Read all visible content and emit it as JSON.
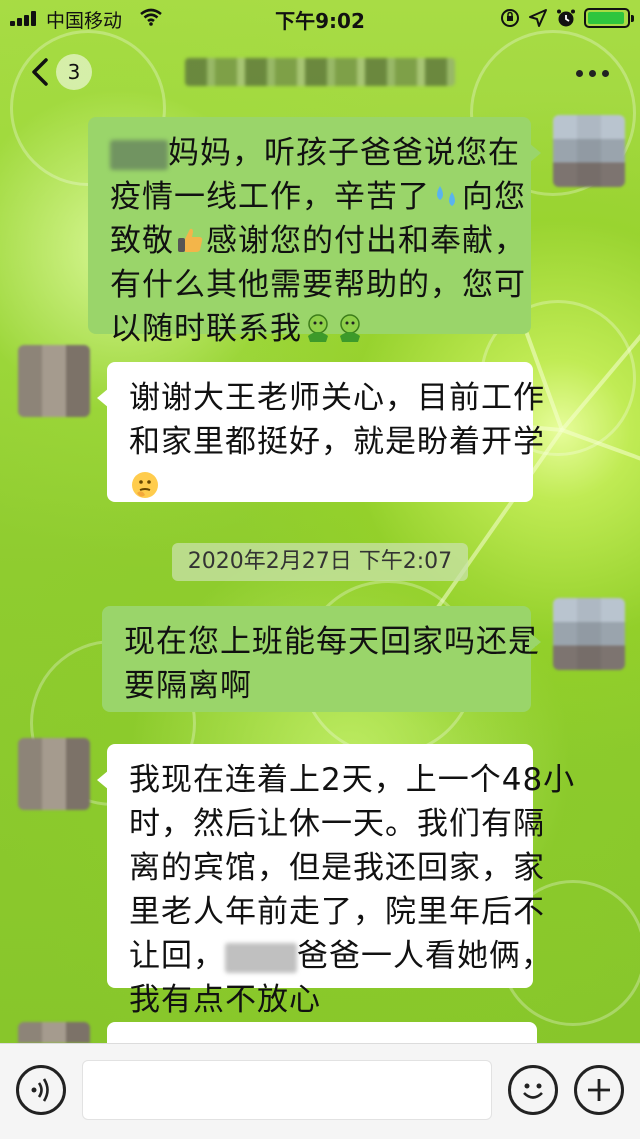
{
  "status_bar": {
    "carrier": "中国移动",
    "time": "下午9:02",
    "battery_level": 1.0,
    "icons": [
      "signal-icon",
      "wifi-icon",
      "rotation-lock-icon",
      "location-icon",
      "alarm-icon",
      "battery-icon"
    ]
  },
  "nav": {
    "back_icon": "chevron-left-icon",
    "unread_count": "3",
    "more_icon": "more-icon"
  },
  "messages": [
    {
      "side": "right",
      "lines": [
        "妈妈，听孩子爸爸说您在",
        "疫情一线工作，辛苦了",
        "致敬",
        "有什么其他需要帮助的，您可",
        "以随时联系我"
      ],
      "parts": {
        "l1": "妈妈，听孩子爸爸说您在",
        "l2a": "疫情一线工作，辛苦了",
        "l2b": "向您",
        "l3a": "致敬",
        "l3b": "感谢您的付出和奉献，",
        "l4": "有什么其他需要帮助的，您可",
        "l5": "以随时联系我"
      },
      "emojis": [
        "sweat-droplets-emoji",
        "thumbs-up-emoji",
        "hug-emoji",
        "hug-emoji"
      ]
    },
    {
      "side": "left",
      "parts": {
        "l1": "谢谢大王老师关心，目前工作",
        "l2": "和家里都挺好，就是盼着开学"
      },
      "emojis": [
        "thinking-emoji"
      ]
    },
    {
      "side": "right",
      "parts": {
        "l1": "现在您上班能每天回家吗还是",
        "l2": "要隔离啊"
      }
    },
    {
      "side": "left",
      "parts": {
        "l1": "我现在连着上2天，上一个48小",
        "l2": "时，然后让休一天。我们有隔",
        "l3": "离的宾馆，但是我还回家，家",
        "l4": "里老人年前走了，院里年后不",
        "l5a": "让回，",
        "l5b": "爸爸一人看她俩，",
        "l6": "我有点不放心"
      }
    }
  ],
  "timestamp": "2020年2月27日 下午2:07",
  "input_bar": {
    "voice_icon": "voice-icon",
    "emoji_icon": "emoji-icon",
    "plus_icon": "plus-icon",
    "text_value": ""
  },
  "colors": {
    "outgoing_bubble": "#9ad56a",
    "incoming_bubble": "#ffffff",
    "background": "#9fd43a"
  }
}
